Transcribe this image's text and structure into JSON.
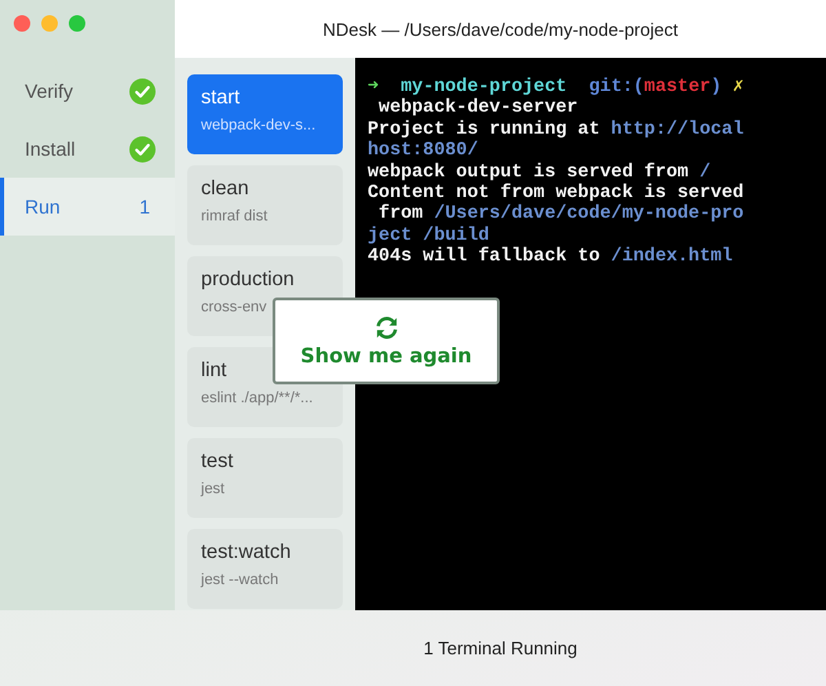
{
  "window": {
    "title": "NDesk — /Users/dave/code/my-node-project"
  },
  "steps": [
    {
      "label": "Verify",
      "kind": "done",
      "selected": false
    },
    {
      "label": "Install",
      "kind": "done",
      "selected": false
    },
    {
      "label": "Run",
      "kind": "count",
      "count": "1",
      "selected": true
    }
  ],
  "tasks": [
    {
      "name": "start",
      "command": "webpack-dev-s...",
      "selected": true
    },
    {
      "name": "clean",
      "command": "rimraf dist",
      "selected": false
    },
    {
      "name": "production",
      "command": "cross-env",
      "selected": false
    },
    {
      "name": "lint",
      "command": "eslint ./app/**/*...",
      "selected": false
    },
    {
      "name": "test",
      "command": "jest",
      "selected": false
    },
    {
      "name": "test:watch",
      "command": "jest --watch",
      "selected": false
    }
  ],
  "terminal": {
    "lines": [
      [
        {
          "text": "➜",
          "kind": "arrow"
        },
        {
          "text": "  my-node-project",
          "kind": "dir"
        },
        {
          "text": "  git:(",
          "kind": "git"
        },
        {
          "text": "master",
          "kind": "branch"
        },
        {
          "text": ")",
          "kind": "git"
        },
        {
          "text": " ✗",
          "kind": "mark"
        }
      ],
      [
        {
          "text": " webpack-dev-server",
          "kind": "plain"
        }
      ],
      [
        {
          "text": "Project is running at ",
          "kind": "plain"
        },
        {
          "text": "http://local",
          "kind": "path"
        }
      ],
      [
        {
          "text": "host:8080/",
          "kind": "path"
        }
      ],
      [
        {
          "text": "webpack output is served from ",
          "kind": "plain"
        },
        {
          "text": "/",
          "kind": "path"
        }
      ],
      [
        {
          "text": "Content not from webpack is served",
          "kind": "plain"
        }
      ],
      [
        {
          "text": " from ",
          "kind": "plain"
        },
        {
          "text": "/Users/dave/code/my-node-pro",
          "kind": "path"
        }
      ],
      [
        {
          "text": "ject /build",
          "kind": "path"
        }
      ],
      [
        {
          "text": "404s will fallback to ",
          "kind": "plain"
        },
        {
          "text": "/index.html",
          "kind": "path"
        }
      ]
    ]
  },
  "popup": {
    "label": "Show me again"
  },
  "status_bar": {
    "text": "1 Terminal Running"
  }
}
